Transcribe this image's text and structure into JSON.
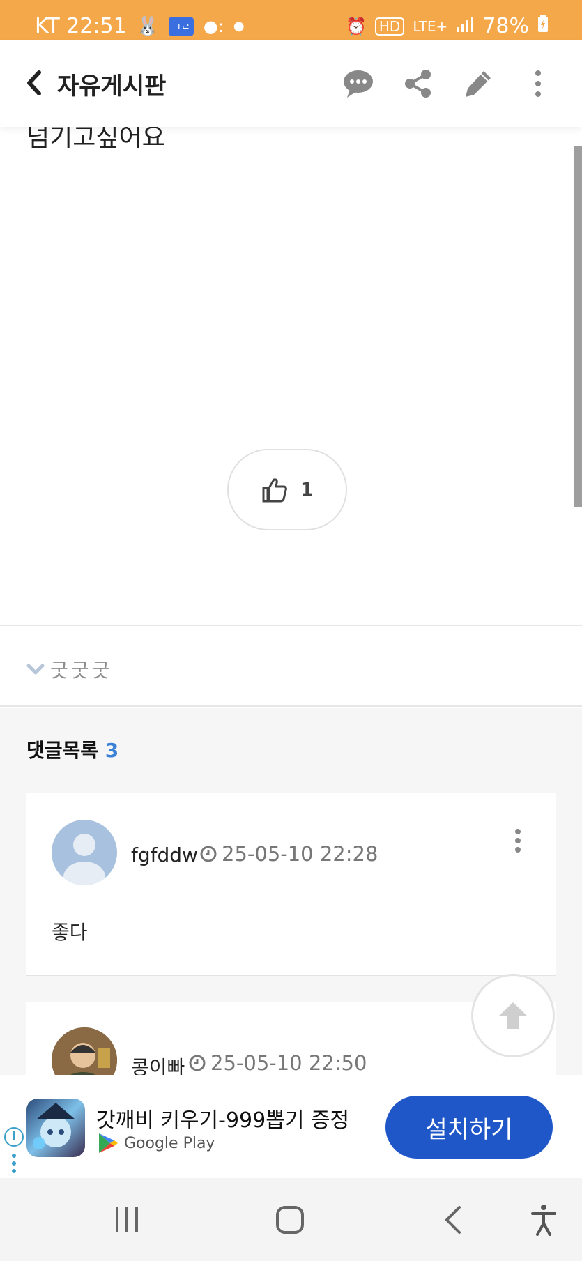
{
  "status_bar": {
    "carrier_time": "KT 22:51",
    "app_badge": "ㄱㄹ",
    "network": "LTE+",
    "hd": "HD",
    "battery": "78%"
  },
  "header": {
    "title": "자유게시판",
    "icons": [
      "back-icon",
      "comment-icon",
      "share-icon",
      "edit-icon",
      "more-icon"
    ]
  },
  "post": {
    "body_tail": "넘기고싶어요",
    "like_count": "1",
    "tag": "굿굿굿"
  },
  "comments": {
    "title": "댓글목록",
    "count": "3",
    "items": [
      {
        "author": "fgfddw",
        "time": "25-05-10 22:28",
        "body": "좋다"
      },
      {
        "author": "콩이빠",
        "time": "25-05-10 22:50",
        "body": ""
      }
    ]
  },
  "ad": {
    "title": "갓깨비 키우기-999뽑기 증정",
    "store": "Google Play",
    "install_label": "설치하기"
  },
  "colors": {
    "status_bar": "#f4a84a",
    "accent_blue": "#3b82d6",
    "install_button": "#1f57c8"
  }
}
